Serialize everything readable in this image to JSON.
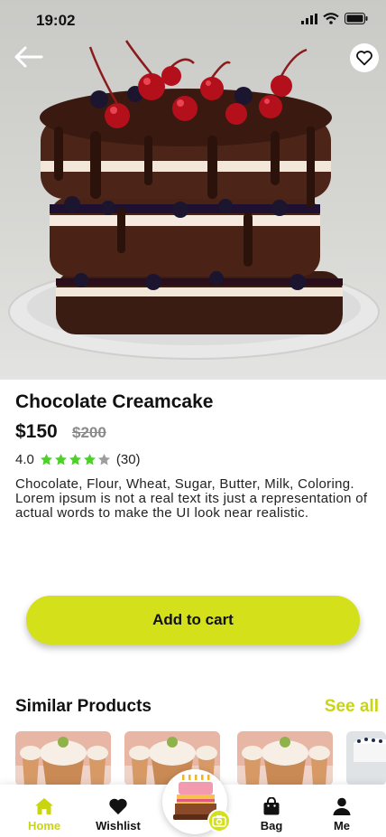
{
  "status": {
    "time": "19:02"
  },
  "product": {
    "title": "Chocolate Creamcake",
    "price": "$150",
    "old_price": "$200",
    "rating": "4.0",
    "rating_count": "(30)",
    "stars_filled": 4,
    "stars_total": 5,
    "description": "Chocolate, Flour, Wheat, Sugar, Butter, Milk, Coloring. Lorem ipsum is not a real text its just a representation of actual words to make the UI look near realistic."
  },
  "actions": {
    "add_to_cart": "Add to cart"
  },
  "similar": {
    "title": "Similar Products",
    "see_all": "See all"
  },
  "nav": {
    "items": [
      {
        "label": "Home",
        "icon": "home-icon",
        "active": true
      },
      {
        "label": "Wishlist",
        "icon": "heart-icon",
        "active": false
      },
      {
        "label": "Bag",
        "icon": "bag-icon",
        "active": false
      },
      {
        "label": "Me",
        "icon": "person-icon",
        "active": false
      }
    ],
    "center_icon": "cake-camera-icon"
  },
  "colors": {
    "accent": "#d3e01a",
    "accent_text": "#c9d60f",
    "star": "#4cd12a",
    "star_empty": "#9e9e9e"
  }
}
